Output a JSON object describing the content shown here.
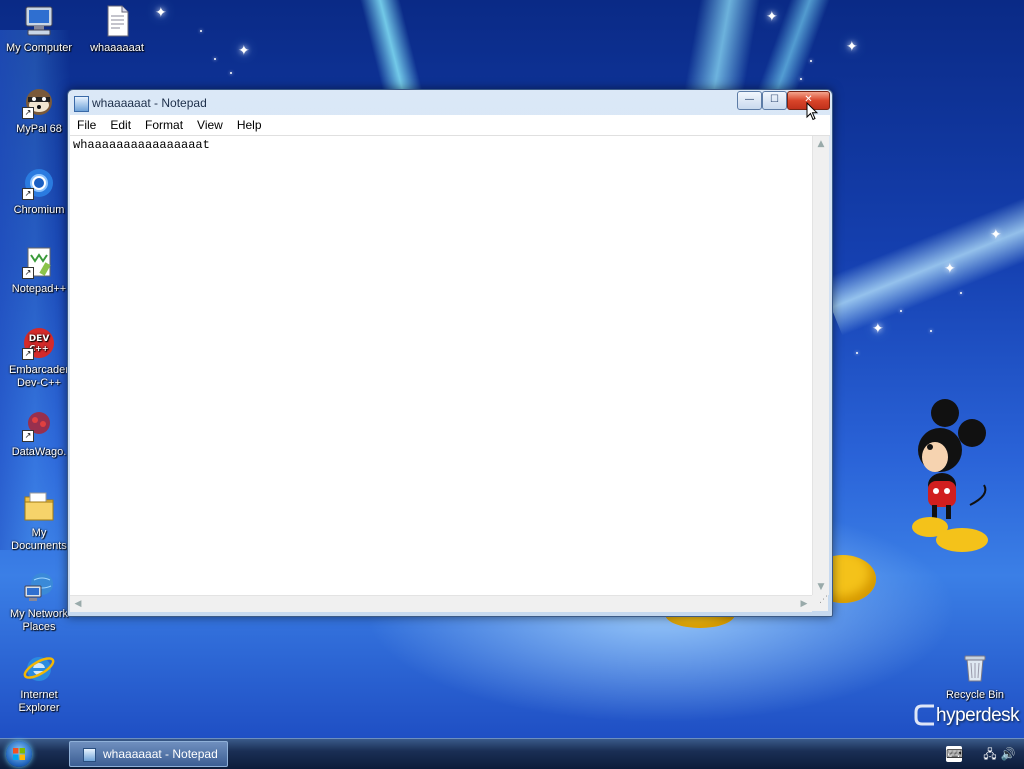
{
  "desktop": {
    "icons": [
      {
        "label": "My Computer",
        "icon": "my-computer-icon"
      },
      {
        "label": "whaaaaaat",
        "icon": "text-file-icon"
      },
      {
        "label": "MyPal 68",
        "icon": "mypal-browser-icon"
      },
      {
        "label": "Chromium",
        "icon": "chromium-icon"
      },
      {
        "label": "Notepad++",
        "icon": "notepad-plus-plus-icon"
      },
      {
        "label": "Embarcader\nDev-C++",
        "icon": "dev-cpp-icon"
      },
      {
        "label": "DataWago.",
        "icon": "datawago-icon"
      },
      {
        "label": "My\nDocuments",
        "icon": "my-documents-icon"
      },
      {
        "label": "My Network\nPlaces",
        "icon": "network-places-icon"
      },
      {
        "label": "Internet\nExplorer",
        "icon": "internet-explorer-icon"
      },
      {
        "label": "Recycle Bin",
        "icon": "recycle-bin-icon"
      }
    ],
    "brand": "hyperdesk"
  },
  "window": {
    "title": "whaaaaaat - Notepad",
    "controls": {
      "minimize": "—",
      "maximize": "☐",
      "close": "✕"
    },
    "menu": [
      "File",
      "Edit",
      "Format",
      "View",
      "Help"
    ],
    "content": "whaaaaaaaaaaaaaaaat"
  },
  "taskbar": {
    "tasks": [
      {
        "label": "whaaaaaat - Notepad",
        "icon": "notepad-icon"
      }
    ],
    "tray_icons": [
      "keyboard-icon",
      "network-icon",
      "volume-icon"
    ]
  },
  "colors": {
    "close_button": "#d9452a",
    "desktop_blue": "#1f4fc4",
    "taskbar": "#1a2f55"
  }
}
